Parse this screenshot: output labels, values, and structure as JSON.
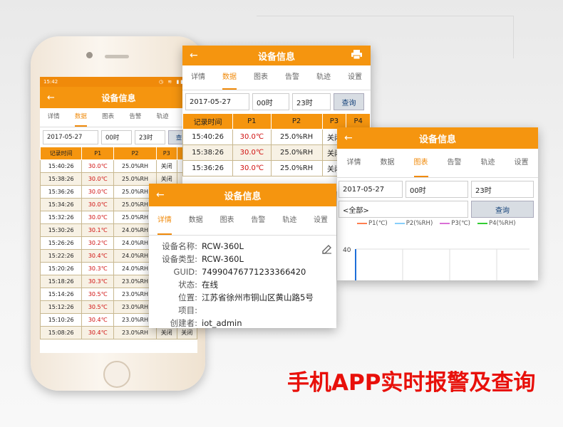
{
  "slogan": "手机APP实时报警及查询",
  "phone": {
    "status_time": "15:42",
    "title": "设备信息",
    "tabs": [
      "详情",
      "数据",
      "图表",
      "告警",
      "轨迹",
      "设"
    ],
    "active_tab": "数据",
    "date": "2017-05-27",
    "start_hour": "00时",
    "end_hour": "23时",
    "query_label": "查",
    "columns": [
      "记录时间",
      "P1",
      "P2",
      "P3",
      "P"
    ],
    "rows": [
      [
        "15:40:26",
        "30.0℃",
        "25.0%RH",
        "关闭",
        "关"
      ],
      [
        "15:38:26",
        "30.0℃",
        "25.0%RH",
        "关闭",
        "关"
      ],
      [
        "15:36:26",
        "30.0℃",
        "25.0%RH",
        "关闭",
        "关"
      ],
      [
        "15:34:26",
        "30.0℃",
        "25.0%RH",
        "关闭",
        "关"
      ],
      [
        "15:32:26",
        "30.0℃",
        "25.0%RH",
        "关闭",
        "关"
      ],
      [
        "15:30:26",
        "30.1℃",
        "24.0%RH",
        "关闭",
        "关"
      ],
      [
        "15:26:26",
        "30.2℃",
        "24.0%RH",
        "关闭",
        "关"
      ],
      [
        "15:22:26",
        "30.4℃",
        "24.0%RH",
        "关闭",
        "关"
      ],
      [
        "15:20:26",
        "30.3℃",
        "24.0%RH",
        "关闭",
        "关"
      ],
      [
        "15:18:26",
        "30.3℃",
        "23.0%RH",
        "关闭",
        "关"
      ],
      [
        "15:14:26",
        "30.5℃",
        "23.0%RH",
        "关闭",
        "关"
      ],
      [
        "15:12:26",
        "30.5℃",
        "23.0%RH",
        "关闭",
        "关"
      ],
      [
        "15:10:26",
        "30.4℃",
        "23.0%RH",
        "关闭",
        "关闭"
      ],
      [
        "15:08:26",
        "30.4℃",
        "23.0%RH",
        "关闭",
        "关闭"
      ]
    ]
  },
  "card_data": {
    "title": "设备信息",
    "tabs": [
      "详情",
      "数据",
      "图表",
      "告警",
      "轨迹",
      "设置"
    ],
    "active_tab": "数据",
    "date": "2017-05-27",
    "start_hour": "00时",
    "end_hour": "23时",
    "query_label": "查询",
    "columns": [
      "记录时间",
      "P1",
      "P2",
      "P3",
      "P4"
    ],
    "rows": [
      [
        "15:40:26",
        "30.0℃",
        "25.0%RH",
        "关闭",
        "关闭"
      ],
      [
        "15:38:26",
        "30.0℃",
        "25.0%RH",
        "关闭",
        "关闭"
      ],
      [
        "15:36:26",
        "30.0℃",
        "25.0%RH",
        "关闭",
        "关闭"
      ]
    ]
  },
  "card_chart": {
    "title": "设备信息",
    "tabs": [
      "详情",
      "数据",
      "图表",
      "告警",
      "轨迹",
      "设置"
    ],
    "active_tab": "图表",
    "date": "2017-05-27",
    "start_hour": "00时",
    "end_hour": "23时",
    "select_value": "<全部>",
    "query_label": "查询",
    "legend": [
      {
        "label": "P1(℃)",
        "color": "#ff7f50"
      },
      {
        "label": "P2(%RH)",
        "color": "#87cefa"
      },
      {
        "label": "P3(℃)",
        "color": "#da70d6"
      },
      {
        "label": "P4(%RH)",
        "color": "#32cd32"
      }
    ],
    "y_tick": "40"
  },
  "card_detail": {
    "title": "设备信息",
    "tabs": [
      "详情",
      "数据",
      "图表",
      "告警",
      "轨迹",
      "设置"
    ],
    "active_tab": "详情",
    "fields": [
      {
        "key": "设备名称:",
        "value": "RCW-360L"
      },
      {
        "key": "设备类型:",
        "value": "RCW-360L"
      },
      {
        "key": "GUID:",
        "value": "74990476771233366420"
      },
      {
        "key": "状态:",
        "value": "在线"
      },
      {
        "key": "位置:",
        "value": "江苏省徐州市铜山区黄山路5号"
      },
      {
        "key": "项目:",
        "value": ""
      },
      {
        "key": "创建者:",
        "value": "iot_admin"
      }
    ]
  },
  "colors": {
    "accent": "#f5950f",
    "alarm_text": "#d01010",
    "slogan": "#e8100a"
  }
}
